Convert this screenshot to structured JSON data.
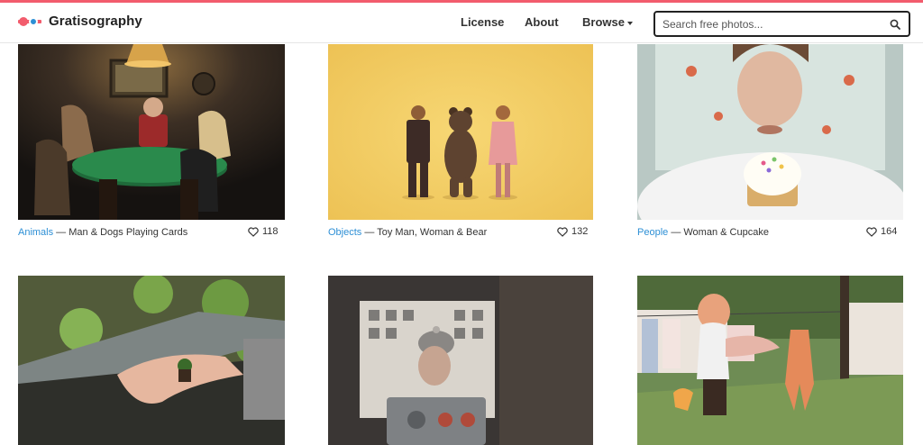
{
  "header": {
    "brand": "Gratisography",
    "nav": {
      "license": "License",
      "about": "About",
      "browse": "Browse"
    },
    "search": {
      "placeholder": "Search free photos..."
    }
  },
  "photos": [
    {
      "category": "Animals",
      "title": " — Man & Dogs Playing Cards",
      "likes": "118"
    },
    {
      "category": "Objects",
      "title": " — Toy Man, Woman & Bear",
      "likes": "132"
    },
    {
      "category": "People",
      "title": " — Woman & Cupcake",
      "likes": "164"
    },
    {
      "category": "",
      "title": "",
      "likes": ""
    },
    {
      "category": "",
      "title": "",
      "likes": ""
    },
    {
      "category": "",
      "title": "",
      "likes": ""
    }
  ],
  "colors": {
    "accent_bar": "#f25c6d",
    "link": "#2d8fd5"
  },
  "icons": [
    "logo-icon",
    "search-icon",
    "heart-icon",
    "caret-down-icon"
  ]
}
